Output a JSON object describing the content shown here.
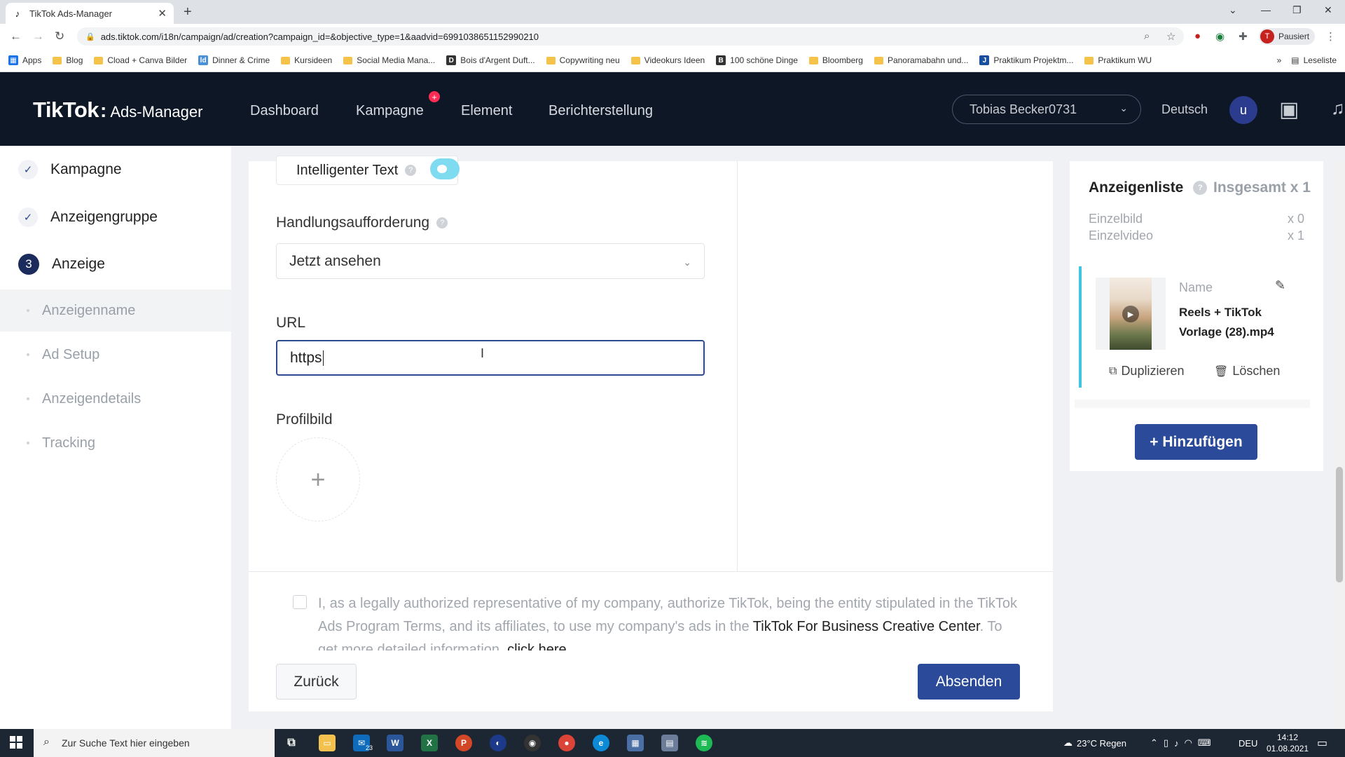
{
  "browser": {
    "tab_title": "TikTok Ads-Manager",
    "url": "ads.tiktok.com/i18n/campaign/ad/creation?campaign_id=&objective_type=1&aadvid=6991038651152990210",
    "profile_status": "Pausiert",
    "profile_initial": "T",
    "bookmarks": [
      {
        "label": "Apps",
        "icon": "apps-grid-icon"
      },
      {
        "label": "Blog",
        "icon": "folder-icon"
      },
      {
        "label": "Cload + Canva Bilder",
        "icon": "folder-icon"
      },
      {
        "label": "Dinner & Crime",
        "icon": "site-icon"
      },
      {
        "label": "Kursideen",
        "icon": "folder-icon"
      },
      {
        "label": "Social Media Mana...",
        "icon": "folder-icon"
      },
      {
        "label": "Bois d'Argent Duft...",
        "icon": "site-icon"
      },
      {
        "label": "Copywriting neu",
        "icon": "folder-icon"
      },
      {
        "label": "Videokurs Ideen",
        "icon": "folder-icon"
      },
      {
        "label": "100 schöne Dinge",
        "icon": "site-icon"
      },
      {
        "label": "Bloomberg",
        "icon": "folder-icon"
      },
      {
        "label": "Panoramabahn und...",
        "icon": "folder-icon"
      },
      {
        "label": "Praktikum Projektm...",
        "icon": "site-icon"
      },
      {
        "label": "Praktikum WU",
        "icon": "folder-icon"
      }
    ],
    "reading_list": "Leseliste"
  },
  "header": {
    "brand": "TikTok",
    "product": "Ads-Manager",
    "nav": [
      "Dashboard",
      "Kampagne",
      "Element",
      "Berichterstellung"
    ],
    "nav_badge": "+",
    "account": "Tobias Becker0731",
    "language": "Deutsch",
    "user_initial": "u"
  },
  "sidebar": {
    "steps": [
      {
        "label": "Kampagne",
        "state": "done",
        "marker": "✓"
      },
      {
        "label": "Anzeigengruppe",
        "state": "done",
        "marker": "✓"
      },
      {
        "label": "Anzeige",
        "state": "current",
        "marker": "3"
      }
    ],
    "substeps": [
      {
        "label": "Anzeigenname",
        "active": true
      },
      {
        "label": "Ad Setup",
        "active": false
      },
      {
        "label": "Anzeigendetails",
        "active": false
      },
      {
        "label": "Tracking",
        "active": false
      }
    ]
  },
  "form": {
    "smart_text_label": "Intelligenter Text",
    "smart_text_enabled": true,
    "cta_label": "Handlungsaufforderung",
    "cta_value": "Jetzt ansehen",
    "url_label": "URL",
    "url_value": "https",
    "profile_label": "Profilbild",
    "consent_text": "I, as a legally authorized representative of my company, authorize TikTok, being the entity stipulated in the TikTok Ads Program Terms, and its affiliates, to use my company's ads in the",
    "consent_link1": "TikTok For Business Creative Center",
    "consent_text2": ". To get more detailed information,",
    "consent_link2": "click here",
    "back_label": "Zurück",
    "submit_label": "Absenden"
  },
  "adlist": {
    "title": "Anzeigenliste",
    "total": "Insgesamt x 1",
    "rows": [
      {
        "label": "Einzelbild",
        "count": "x 0"
      },
      {
        "label": "Einzelvideo",
        "count": "x 1"
      }
    ],
    "item": {
      "name_label": "Name",
      "name": "Reels + TikTok Vorlage (28).mp4",
      "duplicate_label": "Duplizieren",
      "delete_label": "Löschen"
    },
    "add_label": "+ Hinzufügen"
  },
  "taskbar": {
    "search_placeholder": "Zur Suche Text hier eingeben",
    "mail_badge": "23",
    "weather": "23°C  Regen",
    "input_lang": "DEU",
    "time": "14:12",
    "date": "01.08.2021"
  },
  "colors": {
    "header_bg": "#0e1726",
    "primary_button": "#2b4b9a",
    "accent_cyan": "#3cc6e0",
    "badge_red": "#fe2c55"
  }
}
